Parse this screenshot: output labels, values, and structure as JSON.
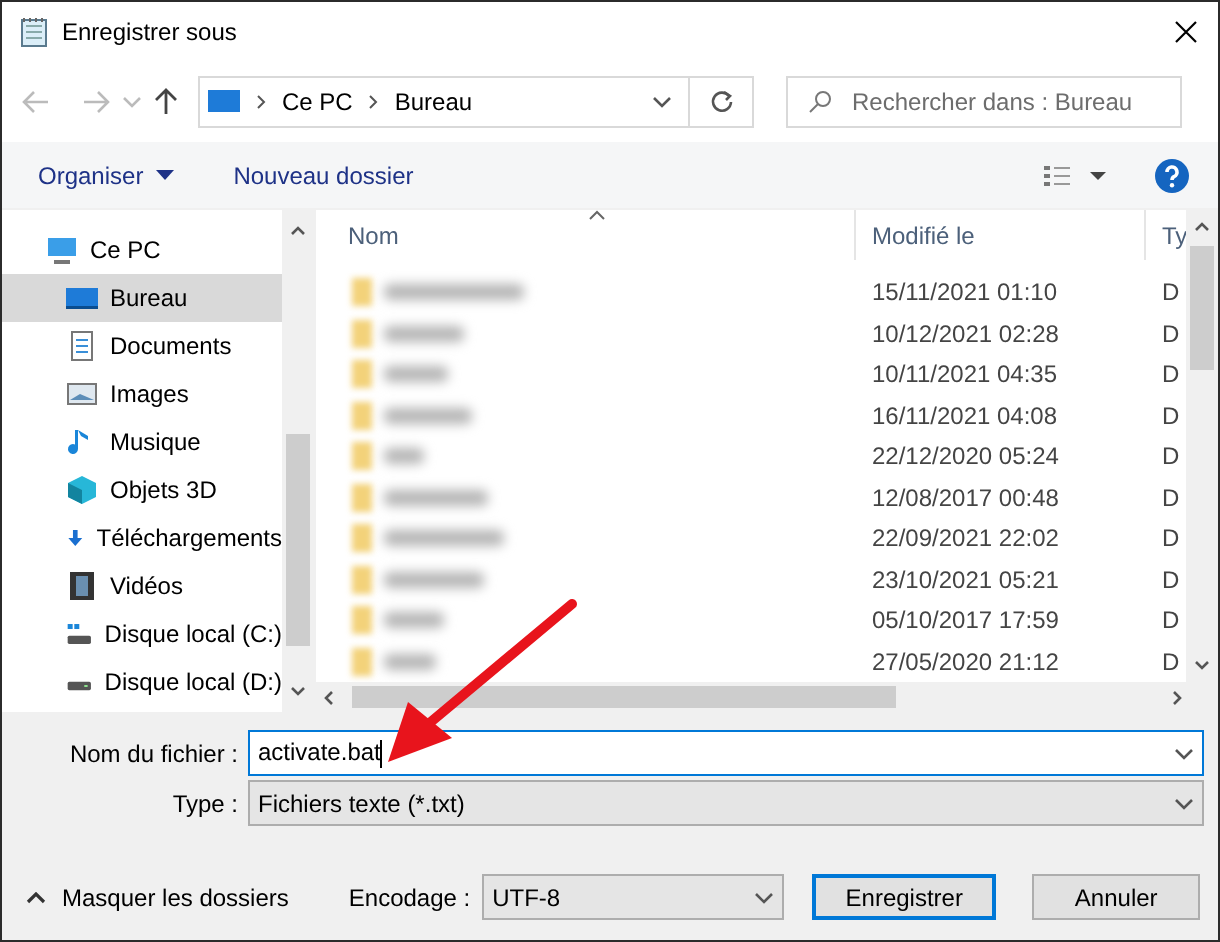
{
  "window": {
    "title": "Enregistrer sous"
  },
  "address_bar": {
    "path": [
      "Ce PC",
      "Bureau"
    ]
  },
  "search": {
    "placeholder": "Rechercher dans : Bureau"
  },
  "toolbar": {
    "organize": "Organiser",
    "new_folder": "Nouveau dossier"
  },
  "sidebar": {
    "items": [
      {
        "label": "Ce PC",
        "kind": "pc",
        "selected": false,
        "children": [
          {
            "label": "Bureau",
            "kind": "desktop",
            "selected": true
          },
          {
            "label": "Documents",
            "kind": "documents",
            "selected": false
          },
          {
            "label": "Images",
            "kind": "images",
            "selected": false
          },
          {
            "label": "Musique",
            "kind": "music",
            "selected": false
          },
          {
            "label": "Objets 3D",
            "kind": "objects3d",
            "selected": false
          },
          {
            "label": "Téléchargements",
            "kind": "downloads",
            "selected": false
          },
          {
            "label": "Vidéos",
            "kind": "videos",
            "selected": false
          },
          {
            "label": "Disque local (C:)",
            "kind": "drive_c",
            "selected": false
          },
          {
            "label": "Disque local (D:)",
            "kind": "drive",
            "selected": false
          }
        ]
      }
    ]
  },
  "file_list": {
    "columns": [
      "Nom",
      "Modifié le",
      "Ty"
    ],
    "rows": [
      {
        "modified": "15/11/2021 01:10",
        "type": "D"
      },
      {
        "modified": "10/12/2021 02:28",
        "type": "D"
      },
      {
        "modified": "10/11/2021 04:35",
        "type": "D"
      },
      {
        "modified": "16/11/2021 04:08",
        "type": "D"
      },
      {
        "modified": "22/12/2020 05:24",
        "type": "D"
      },
      {
        "modified": "12/08/2017 00:48",
        "type": "D"
      },
      {
        "modified": "22/09/2021 22:02",
        "type": "D"
      },
      {
        "modified": "23/10/2021 05:21",
        "type": "D"
      },
      {
        "modified": "05/10/2017 17:59",
        "type": "D"
      },
      {
        "modified": "27/05/2020 21:12",
        "type": "D"
      }
    ]
  },
  "filename": {
    "label": "Nom du fichier :",
    "value": "activate.bat"
  },
  "file_type": {
    "label": "Type :",
    "value": "Fichiers texte (*.txt)"
  },
  "hide_folders": "Masquer les dossiers",
  "encoding": {
    "label": "Encodage :",
    "value": "UTF-8"
  },
  "buttons": [
    {
      "label": "Enregistrer",
      "default": true
    },
    {
      "label": "Annuler",
      "default": false
    }
  ]
}
